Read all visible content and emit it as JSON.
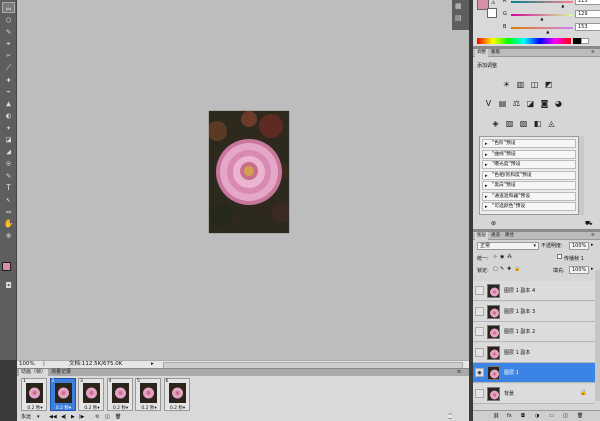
{
  "color_panel": {
    "swatch_fg": "#d68fa3",
    "channels": [
      {
        "label": "R",
        "value": "215",
        "bar": "linear-gradient(90deg,#00818f,#ff818f)",
        "level": 0.843
      },
      {
        "label": "G",
        "value": "129",
        "bar": "linear-gradient(90deg,#d70099,#d7ff99)",
        "level": 0.506
      },
      {
        "label": "B",
        "value": "153",
        "bar": "linear-gradient(90deg,#d78100,#d781ff)",
        "level": 0.6
      }
    ]
  },
  "adjust_panel": {
    "tabs": [
      "调整",
      "蒙版"
    ],
    "title": "添加调整",
    "icons_row1": [
      "☀",
      "▥",
      "◫",
      "◩"
    ],
    "icons_row2": [
      "V",
      "▤",
      "⚖",
      "◪",
      "◙",
      "◕"
    ],
    "icons_row3": [
      "◈",
      "▨",
      "▧",
      "◧",
      "◬"
    ],
    "presets": [
      "\"色阶\"预设",
      "\"曲线\"预设",
      "\"曝光度\"预设",
      "\"色相/饱和度\"预设",
      "\"黑白\"预设",
      "\"通道混和器\"预设",
      "\"可选颜色\"预设"
    ]
  },
  "layers_panel": {
    "tabs": [
      "图层",
      "通道",
      "路径"
    ],
    "blend_mode": "正常",
    "opacity_label": "不透明度:",
    "opacity_value": "100%",
    "unify_label": "统一:",
    "propagate_label": "传播帧 1",
    "lock_label": "锁定:",
    "fill_label": "填充:",
    "fill_value": "100%",
    "layers": [
      {
        "name": "图层 1 副本 4",
        "visible": false,
        "selected": false,
        "locked": false
      },
      {
        "name": "图层 1 副本 3",
        "visible": false,
        "selected": false,
        "locked": false
      },
      {
        "name": "图层 1 副本 2",
        "visible": false,
        "selected": false,
        "locked": false
      },
      {
        "name": "图层 1 副本",
        "visible": false,
        "selected": false,
        "locked": false
      },
      {
        "name": "图层 1",
        "visible": true,
        "selected": true,
        "locked": false
      },
      {
        "name": "背景",
        "visible": false,
        "selected": false,
        "locked": true
      }
    ]
  },
  "status_bar": {
    "zoom": "100%",
    "doc_info": "文档:112.5K/675.0K"
  },
  "animation_panel": {
    "tabs": [
      "动画（帧）",
      "测量记录"
    ],
    "frames": [
      {
        "num": "1",
        "delay": "0.2 秒▾",
        "selected": false
      },
      {
        "num": "2",
        "delay": "0.2 秒▾",
        "selected": true
      },
      {
        "num": "3",
        "delay": "0.2 秒▾",
        "selected": false
      },
      {
        "num": "4",
        "delay": "0.2 秒▾",
        "selected": false
      },
      {
        "num": "5",
        "delay": "0.2 秒▾",
        "selected": false
      },
      {
        "num": "6",
        "delay": "0.2 秒▾",
        "selected": false
      }
    ],
    "loop_label": "永远",
    "controls": [
      "◀◀",
      "◀|",
      "▶",
      "|▶",
      "⟲",
      "◫",
      "🗑"
    ]
  },
  "toolbar": {
    "tools": [
      "▭",
      "○",
      "✎",
      "⌖",
      "✂",
      "⟋",
      "✚",
      "⌁",
      "▲",
      "◐",
      "✦",
      "◪",
      "◢",
      "⊙",
      "✎",
      "T",
      "↖",
      "▭",
      "✋",
      "⊕"
    ],
    "fg_color": "#d68fa3"
  }
}
